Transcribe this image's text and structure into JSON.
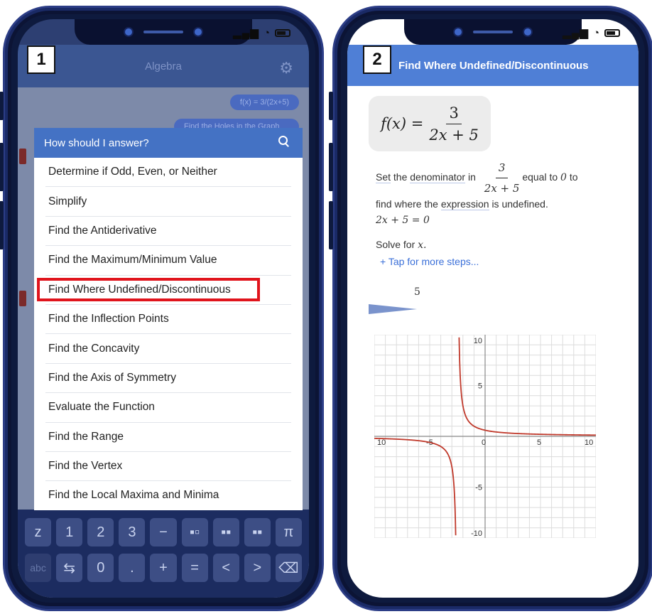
{
  "screen1": {
    "step": "1",
    "header_title": "Algebra",
    "chat": [
      "f(x) = 3/(2x+5)",
      "Find the Holes in the Graph"
    ],
    "dialog": {
      "title": "How should I answer?",
      "options": [
        "Determine if Odd, Even, or Neither",
        "Simplify",
        "Find the Antiderivative",
        "Find the Maximum/Minimum Value",
        "Find Where Undefined/Discontinuous",
        "Find the Inflection Points",
        "Find the Concavity",
        "Find the Axis of Symmetry",
        "Evaluate the Function",
        "Find the Range",
        "Find the Vertex",
        "Find the Local Maxima and Minima"
      ],
      "highlighted": "Find Where Undefined/Discontinuous"
    },
    "keyboard": {
      "row1": [
        "z",
        "1",
        "2",
        "3",
        "−",
        "▪▫",
        "▪▪",
        "▪▪",
        "π"
      ],
      "row2": [
        "abc",
        "⇆",
        "0",
        ".",
        "+",
        "=",
        "<",
        ">",
        "⌫"
      ]
    }
  },
  "screen2": {
    "step": "2",
    "header_title": "Find Where Undefined/Discontinuous",
    "function": {
      "lhs": "f(x) =",
      "num": "3",
      "den": "2x + 5"
    },
    "step1": {
      "set": "Set",
      "the": "the",
      "denominator": "denominator",
      "in": "in",
      "frac_num": "3",
      "frac_den": "2x + 5",
      "equal": "equal to",
      "zero": "0",
      "to": "to",
      "find_where": "find where the",
      "expression": "expression",
      "rest": "is undefined.",
      "equation": "2x + 5 = 0"
    },
    "solve": {
      "text": "Solve for",
      "var": "x."
    },
    "tap": "+ Tap for more steps...",
    "partial_value": "5"
  },
  "chart_data": {
    "type": "line",
    "function": "f(x) = 3/(2x+5)",
    "asymptote_x": -2.5,
    "asymptote_y": 0,
    "xlim": [
      -10,
      10
    ],
    "ylim": [
      -10,
      10
    ],
    "x_tick_labels": [
      "10",
      "-5",
      "0",
      "5",
      "10"
    ],
    "y_tick_labels": [
      "10",
      "5",
      "-5",
      "-10"
    ],
    "grid": true,
    "line_color": "#c0392b"
  }
}
